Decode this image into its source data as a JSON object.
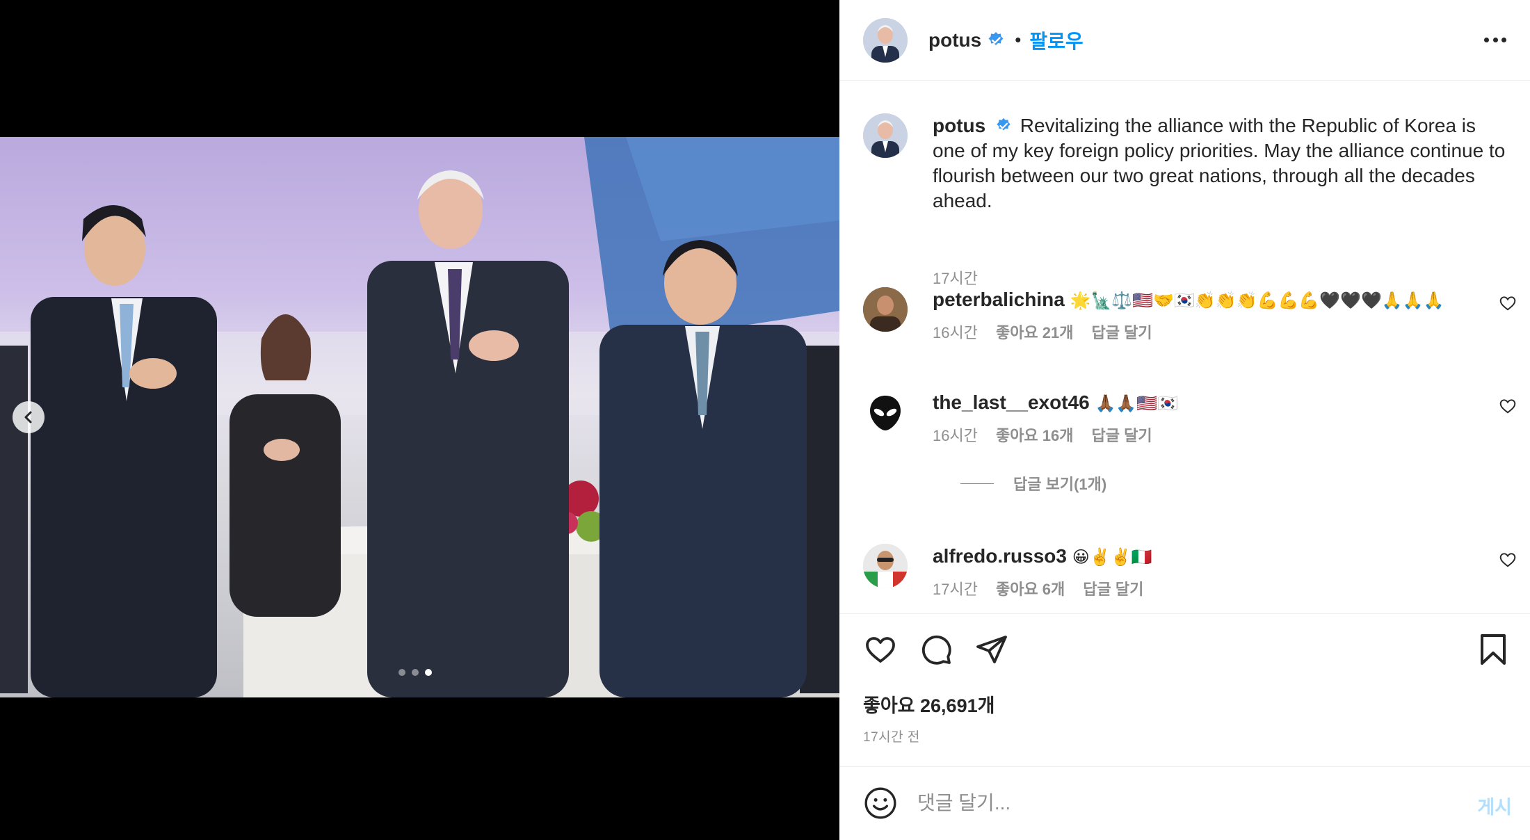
{
  "media": {
    "description_icon": "carousel-photo",
    "slides": 3,
    "active_slide": 3
  },
  "header": {
    "username": "potus",
    "separator": "•",
    "follow_label": "팔로우"
  },
  "caption": {
    "username": "potus",
    "text": "Revitalizing the alliance with the Republic of Korea is one of my key foreign policy priorities. May the alliance continue to flourish between our two great nations, through all the decades ahead.",
    "time": "17시간"
  },
  "comments": [
    {
      "username": "peterbalichina",
      "text": "🌟🗽⚖️🇺🇸🤝🇰🇷👏👏👏💪💪💪🖤🖤🖤🙏🙏🙏",
      "time": "16시간",
      "likes": "좋아요 21개",
      "reply": "답글 달기"
    },
    {
      "username": "the_last__exot46",
      "text": "🙏🏾🙏🏾🇺🇸🇰🇷",
      "time": "16시간",
      "likes": "좋아요 16개",
      "reply": "답글 달기",
      "view_replies": "답글 보기(1개)"
    },
    {
      "username": "alfredo.russo3",
      "text": "😀✌️✌️🇮🇹",
      "time": "17시간",
      "likes": "좋아요 6개",
      "reply": "답글 달기"
    }
  ],
  "actions": {
    "likes_label": "좋아요 26,691개",
    "posted_ago": "17시간 전"
  },
  "comment_box": {
    "placeholder": "댓글 달기...",
    "post_label": "게시"
  },
  "colors": {
    "accent": "#0095f6",
    "verified": "#3897f0",
    "muted": "#8e8e8e",
    "post_disabled": "#b2dffc"
  }
}
